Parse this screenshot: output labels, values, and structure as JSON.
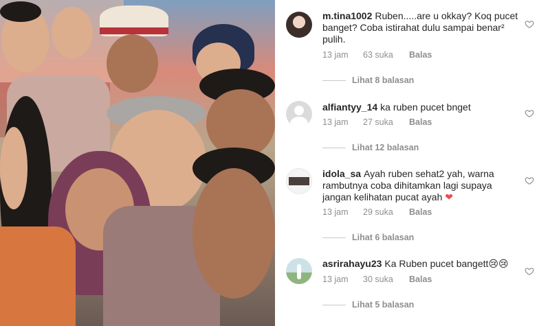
{
  "comments": [
    {
      "username": "m.tina1002",
      "text": "Ruben.....are u okkay? Koq pucet banget? Coba istirahat dulu sampai benar² pulih.",
      "time": "13 jam",
      "likes": "63 suka",
      "reply_label": "Balas",
      "view_replies": "Lihat 8 balasan"
    },
    {
      "username": "alfiantyy_14",
      "text": "ka ruben pucet bnget",
      "time": "13 jam",
      "likes": "27 suka",
      "reply_label": "Balas",
      "view_replies": "Lihat 12 balasan"
    },
    {
      "username": "idola_sa",
      "text": "Ayah ruben sehat2 yah, warna rambutnya coba dihitamkan lagi supaya jangan kelihatan pucat ayah",
      "emoji": "❤",
      "time": "13 jam",
      "likes": "29 suka",
      "reply_label": "Balas",
      "view_replies": "Lihat 6 balasan"
    },
    {
      "username": "asrirahayu23",
      "text": "Ka Ruben pucet bangett",
      "emoji": "😢😢",
      "time": "13 jam",
      "likes": "30 suka",
      "reply_label": "Balas",
      "view_replies": "Lihat 5 balasan"
    }
  ],
  "icons": {
    "like": "heart-outline-icon",
    "default_avatar": "default-avatar-icon"
  },
  "colors": {
    "text": "#262626",
    "meta": "#8e8e8e",
    "heart_red": "#ed4956"
  }
}
